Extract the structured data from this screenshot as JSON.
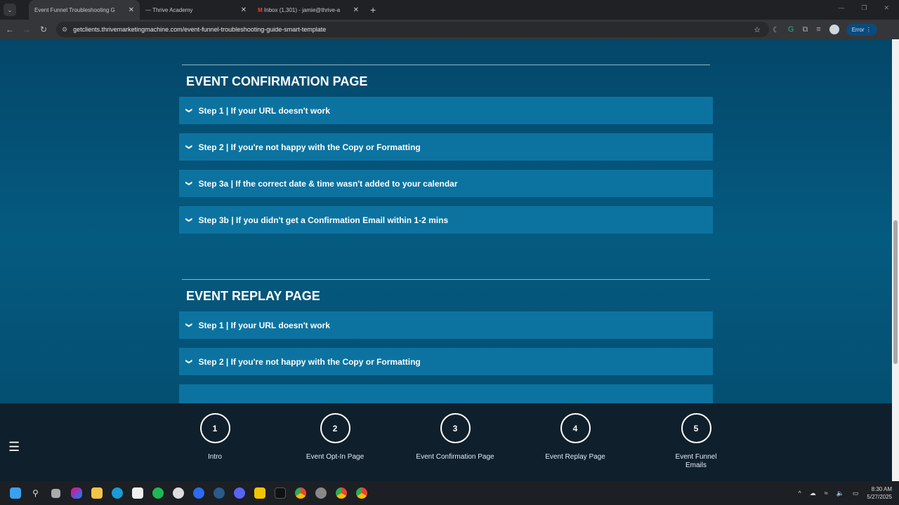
{
  "browser": {
    "tabs": [
      {
        "title": "Event Funnel Troubleshooting G",
        "active": true
      },
      {
        "title": "Thrive Academy",
        "active": false
      },
      {
        "title": "Inbox (1,301) - jamie@thrive-a",
        "active": false
      }
    ],
    "url": "getclients.thrivemarketingmachine.com/event-funnel-troubleshooting-guide-smart-template",
    "profile_button": "Error"
  },
  "sections": [
    {
      "title": "EVENT CONFIRMATION PAGE",
      "items": [
        "Step 1 | If your URL doesn't work",
        "Step 2 | If you're not happy with the Copy or Formatting",
        "Step 3a | If the correct date & time wasn't added to your calendar",
        "Step 3b | If you didn't get a Confirmation Email within 1-2 mins"
      ]
    },
    {
      "title": "EVENT REPLAY PAGE",
      "items": [
        "Step 1 | If your URL doesn't work",
        "Step 2 | If you're not happy with the Copy or Formatting"
      ]
    }
  ],
  "bottom_nav": [
    {
      "number": "1",
      "label": "Intro"
    },
    {
      "number": "2",
      "label": "Event Opt-In Page"
    },
    {
      "number": "3",
      "label": "Event Confirmation Page"
    },
    {
      "number": "4",
      "label": "Event Replay Page"
    },
    {
      "number": "5",
      "label": "Event Funnel Emails"
    }
  ],
  "taskbar": {
    "time": "8:30 AM",
    "date": "5/27/2025"
  },
  "colors": {
    "accordion": "#0c73a0",
    "page_bg": "#055a80",
    "bottom_nav": "#0f1f2c"
  }
}
